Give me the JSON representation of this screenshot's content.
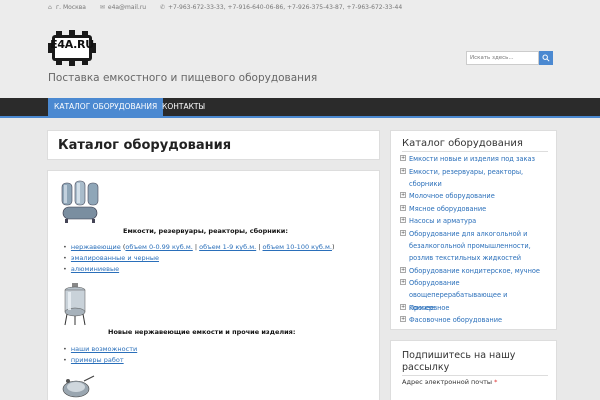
{
  "topbar": {
    "city": "г. Москва",
    "email": "e4a@mail.ru",
    "phones": "+7-963-672-33-33, +7-916-640-06-86, +7-926-375-43-87, +7-963-672-33-44"
  },
  "header": {
    "logo_text": "E4A.RU",
    "tagline": "Поставка емкостного и пищевого оборудования",
    "search_placeholder": "Искать здесь..."
  },
  "nav": [
    {
      "label": "КАТАЛОГ ОБОРУДОВАНИЯ",
      "active": true
    },
    {
      "label": "КОНТАКТЫ",
      "active": false
    }
  ],
  "main": {
    "title": "Каталог оборудования",
    "section1": {
      "heading": "Емкости, резервуары, реакторы, сборники:",
      "link_stainless": "нержавеющие",
      "link_vol1": "объем 0-0.99 куб.м.",
      "link_vol2": "объем 1-9 куб.м.",
      "link_vol3": "объем 10-100 куб.м.",
      "link_enamel": "эмалированные и черные",
      "link_aluminum": "алюминиевые"
    },
    "section2": {
      "heading": "Новые нержавеющие емкости и прочие изделия:",
      "link_capabilities": "наши возможности",
      "link_examples": "примеры работ"
    }
  },
  "sidebar": {
    "title": "Каталог оборудования",
    "categories": [
      "Емкости новые и изделия под заказ",
      "Емкости, резервуары, реакторы, сборники",
      "Молочное оборудование",
      "Мясное оборудование",
      "Насосы и арматура",
      "Оборудование для алкогольной и безалкогольной промышленности, розлив текстильных жидкостей",
      "Оборудование кондитерское, мучное",
      "Оборудование овощеперерабатывающее и консервное",
      "Прочее",
      "Фасовочное оборудование"
    ],
    "newsletter_title": "Подпишитесь на нашу рассылку",
    "email_label": "Адрес электронной почты",
    "required_mark": "*"
  },
  "colors": {
    "accent": "#4b89d1",
    "nav_bg": "#2b2b2b",
    "link": "#2a6fba"
  }
}
